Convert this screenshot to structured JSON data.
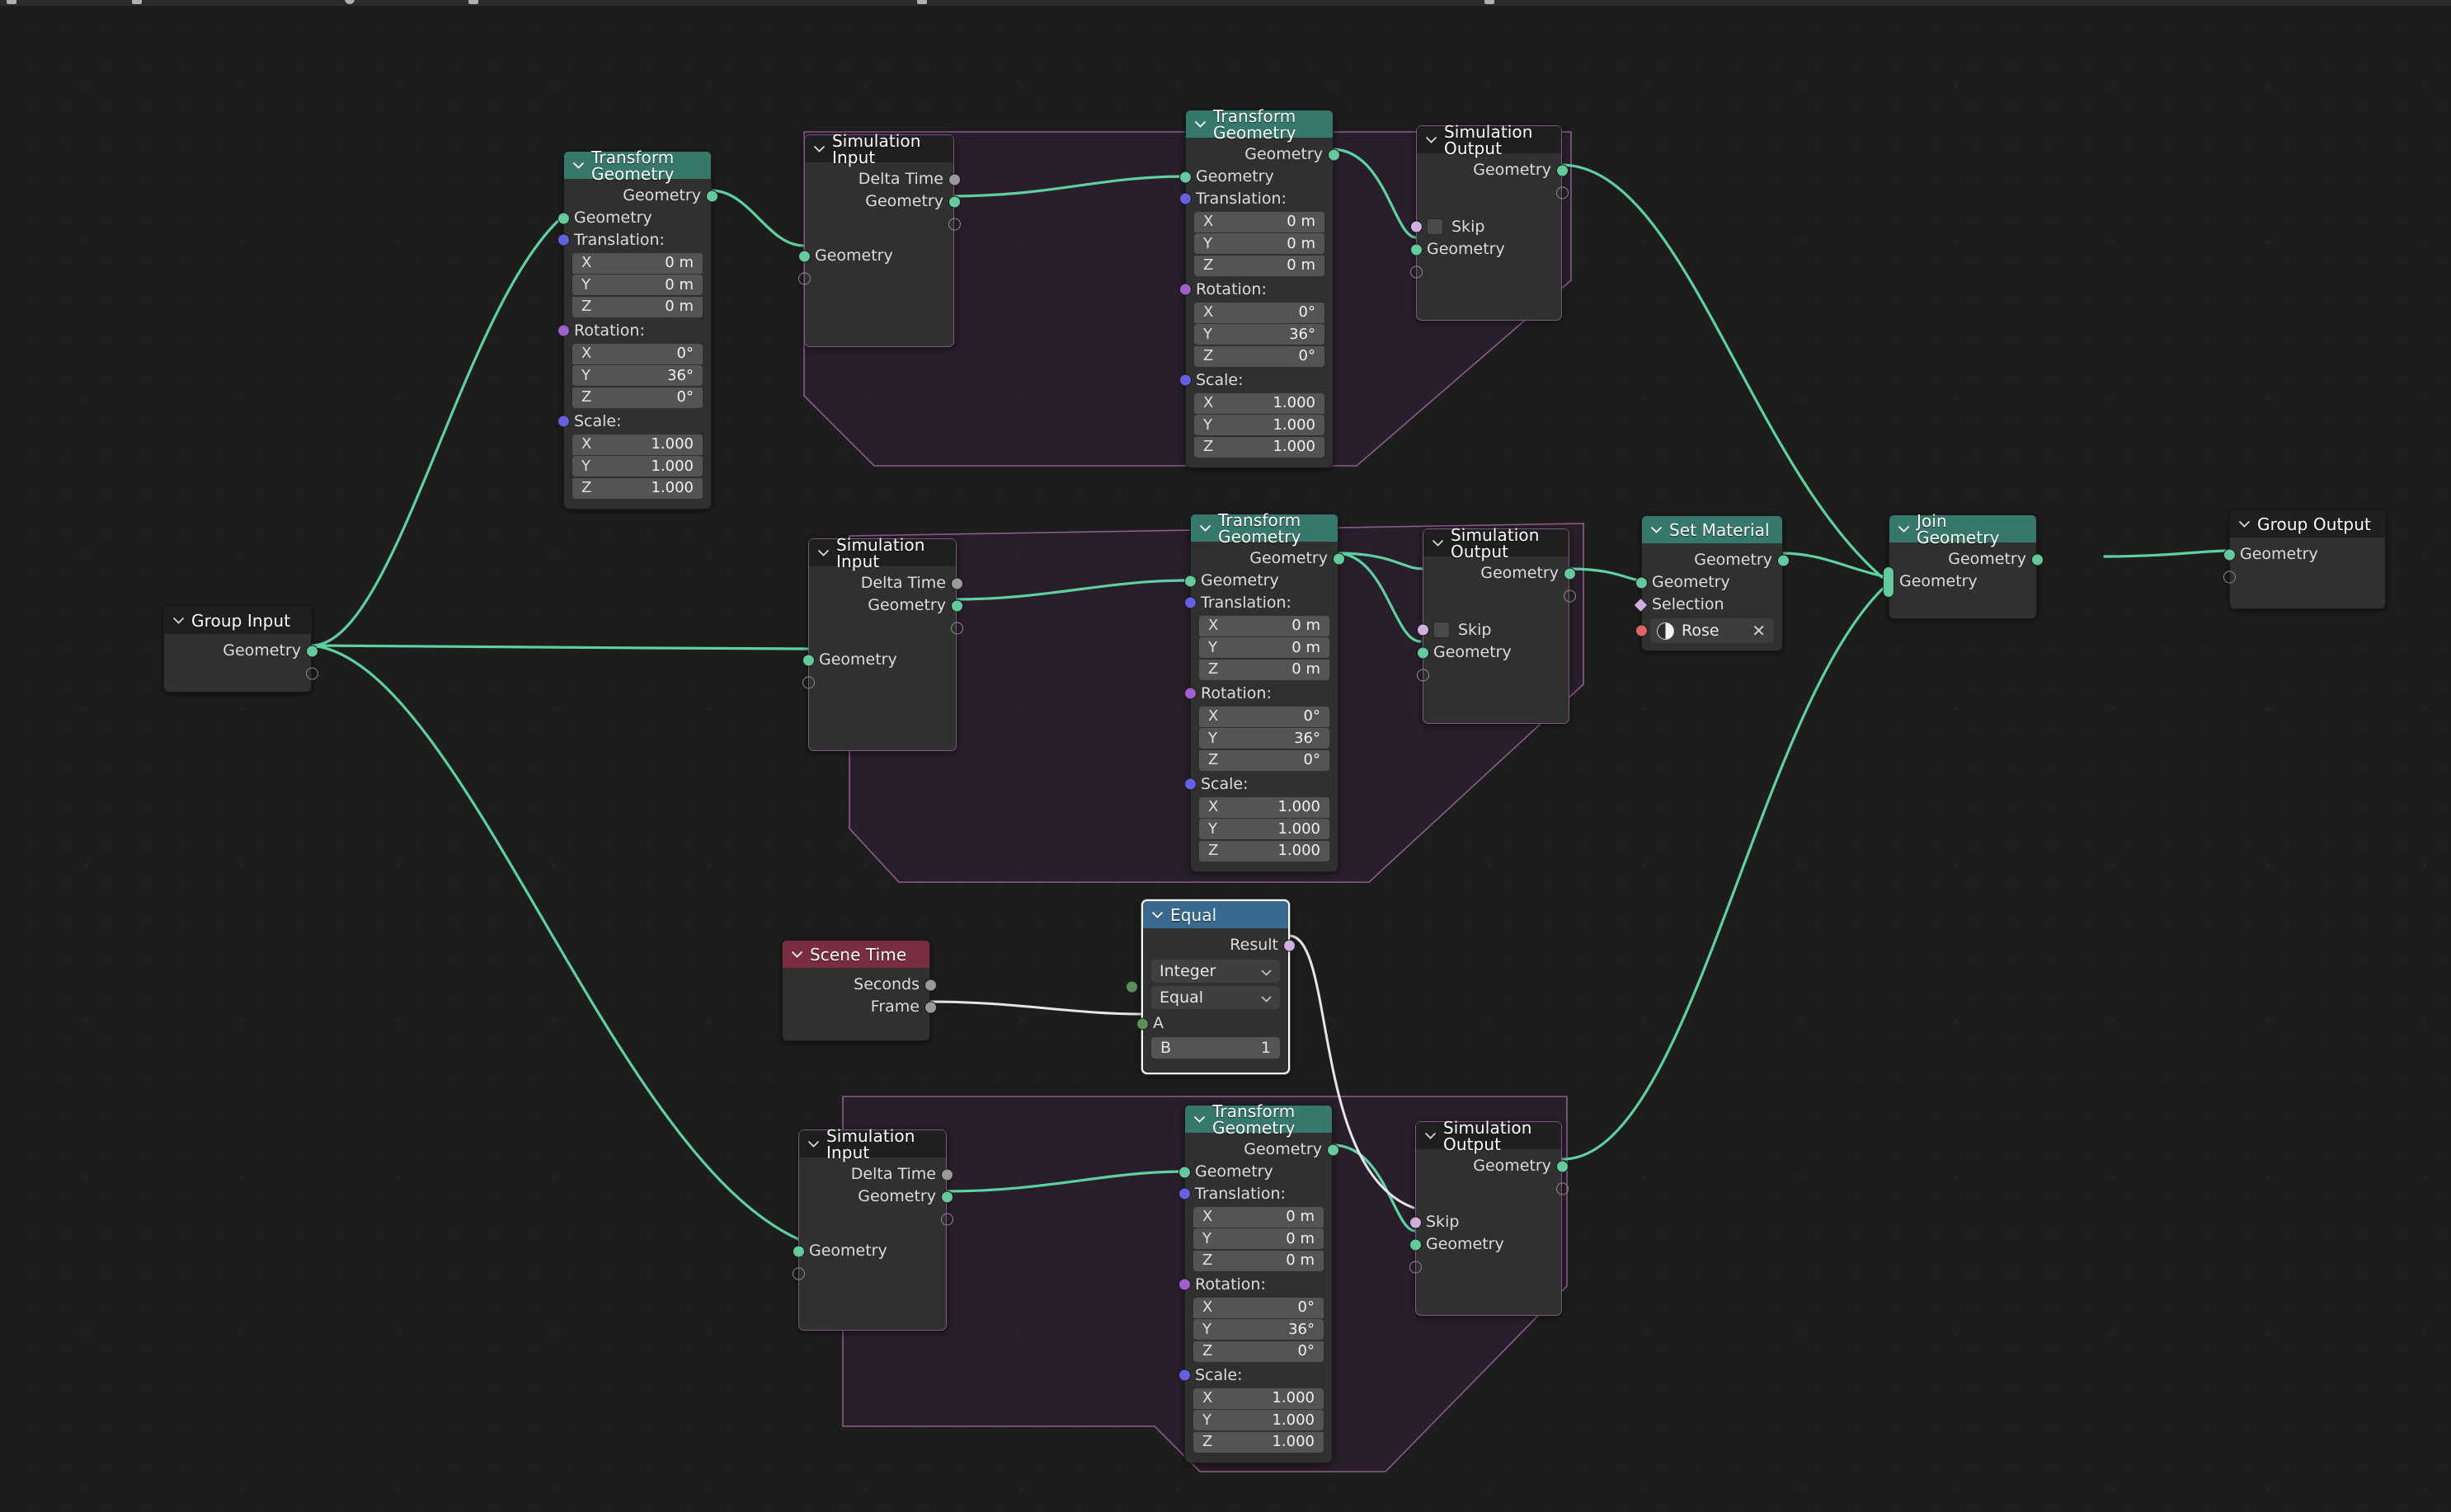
{
  "app": {
    "editor": "Geometry Node Editor",
    "background": "#1d1d1d"
  },
  "colors": {
    "geometry_header": "#36786b",
    "converter_header": "#39698f",
    "input_header": "#7a2c40",
    "plain_header": "#1f1f1f",
    "geometry_socket": "#64c99b",
    "vector_socket": "#6461e0",
    "rotation_socket": "#a05fcc",
    "boolean_socket": "#cfaee0",
    "material_socket": "#e06666",
    "float_socket": "#9a9a9a",
    "integer_socket": "#5a8f5a",
    "zone_border": "#8a5d8a",
    "zone_fill": "#2a1f2c",
    "wire_geometry": "#5fd0a0",
    "wire_field": "#e8e8e8"
  },
  "labels": {
    "geometry": "Geometry",
    "delta_time": "Delta Time",
    "translation": "Translation:",
    "rotation": "Rotation:",
    "scale": "Scale:",
    "skip": "Skip",
    "selection": "Selection",
    "result": "Result",
    "seconds": "Seconds",
    "frame": "Frame",
    "a": "A",
    "b": "B",
    "x": "X",
    "y": "Y",
    "z": "Z",
    "close": "✕"
  },
  "transform_values": {
    "translation": {
      "x": "0 m",
      "y": "0 m",
      "z": "0 m"
    },
    "rotation": {
      "x": "0°",
      "y": "36°",
      "z": "0°"
    },
    "scale": {
      "x": "1.000",
      "y": "1.000",
      "z": "1.000"
    }
  },
  "nodes": {
    "group_input": {
      "title": "Group Input",
      "output_geometry": "Geometry"
    },
    "transform_top": {
      "title": "Transform Geometry"
    },
    "sim_input_top": {
      "title": "Simulation Input"
    },
    "transform_sim_top": {
      "title": "Transform Geometry"
    },
    "sim_output_top": {
      "title": "Simulation Output"
    },
    "sim_input_mid": {
      "title": "Simulation Input"
    },
    "transform_sim_mid": {
      "title": "Transform Geometry"
    },
    "sim_output_mid": {
      "title": "Simulation Output"
    },
    "set_material": {
      "title": "Set Material",
      "material_name": "Rose"
    },
    "join_geometry": {
      "title": "Join Geometry"
    },
    "group_output": {
      "title": "Group Output",
      "input_geometry": "Geometry"
    },
    "scene_time": {
      "title": "Scene Time"
    },
    "equal": {
      "title": "Equal",
      "data_type": "Integer",
      "operation": "Equal",
      "b_value": "1",
      "selected": true
    },
    "sim_input_bot": {
      "title": "Simulation Input"
    },
    "transform_sim_bot": {
      "title": "Transform Geometry"
    },
    "sim_output_bot": {
      "title": "Simulation Output"
    }
  },
  "icons": {
    "collapse": "chevron-down-icon",
    "dropdown": "chevron-down-icon",
    "material": "material-sphere-icon",
    "clear": "close-icon",
    "checkbox": "checkbox-icon"
  }
}
